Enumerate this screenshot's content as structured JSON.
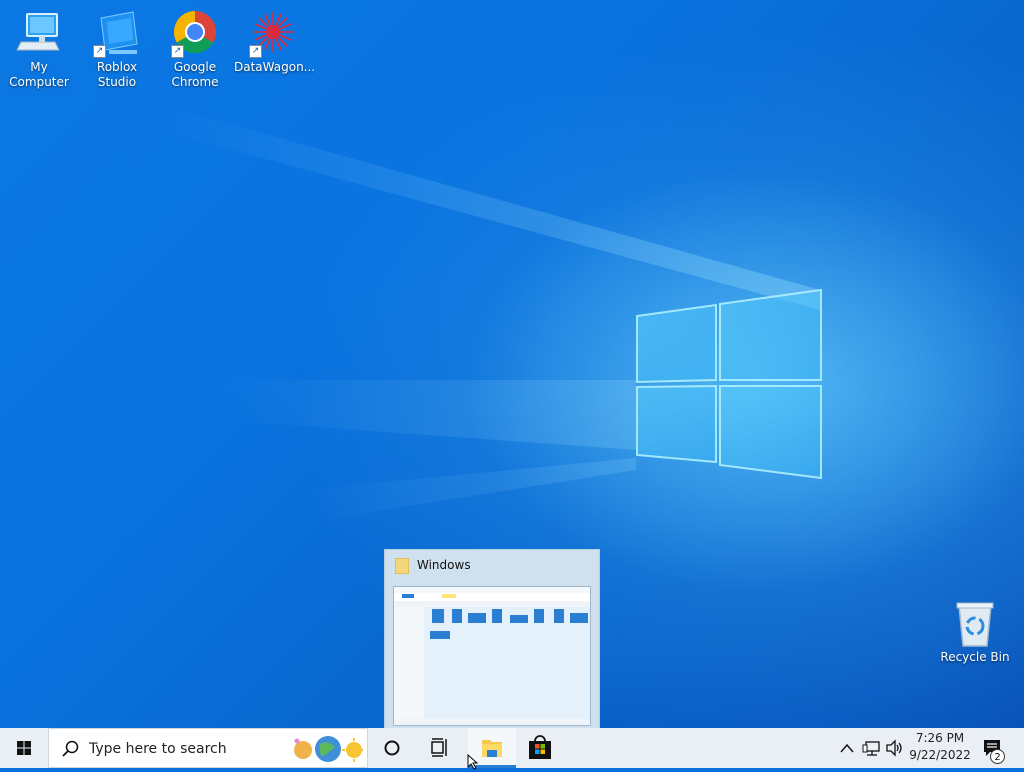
{
  "desktop": {
    "icons": [
      {
        "label": "My Computer",
        "icon": "monitor-icon"
      },
      {
        "label": "Roblox Studio",
        "icon": "roblox-studio-icon"
      },
      {
        "label": "Google\nChrome",
        "icon": "chrome-icon"
      },
      {
        "label": "DataWagon...",
        "icon": "datawagon-icon"
      }
    ],
    "recycle_bin": {
      "label": "Recycle Bin",
      "icon": "recycle-bin-icon"
    }
  },
  "thumbnail": {
    "title": "Windows",
    "icon": "folder-icon"
  },
  "taskbar": {
    "search_placeholder": "Type here to search",
    "clock_time": "7:26 PM",
    "clock_date": "9/22/2022",
    "notification_count": "2",
    "accent_color": "#2b7fd3",
    "apps": [
      {
        "name": "File Explorer",
        "icon": "folder-icon",
        "active": true
      },
      {
        "name": "Microsoft Store",
        "icon": "store-icon",
        "active": false
      }
    ]
  }
}
